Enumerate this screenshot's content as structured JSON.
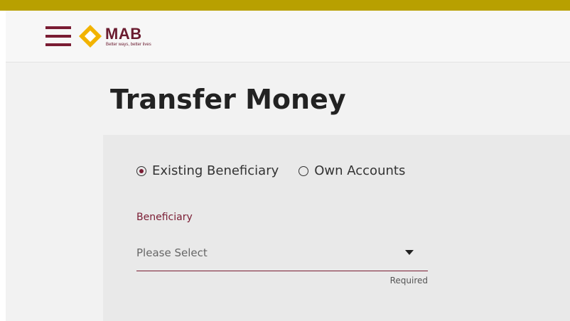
{
  "brand": {
    "name": "MAB",
    "tagline": "Better ways, better lives",
    "primary_color": "#7a1c33",
    "accent_color": "#b8a000",
    "logo_color": "#f2b300"
  },
  "header": {
    "menu_icon": "hamburger-icon"
  },
  "page": {
    "title": "Transfer Money"
  },
  "transfer_type": {
    "options": [
      {
        "label": "Existing Beneficiary",
        "selected": true
      },
      {
        "label": "Own Accounts",
        "selected": false
      }
    ]
  },
  "beneficiary": {
    "label": "Beneficiary",
    "placeholder": "Please Select",
    "hint": "Required",
    "caret_icon": "caret-down-icon"
  }
}
